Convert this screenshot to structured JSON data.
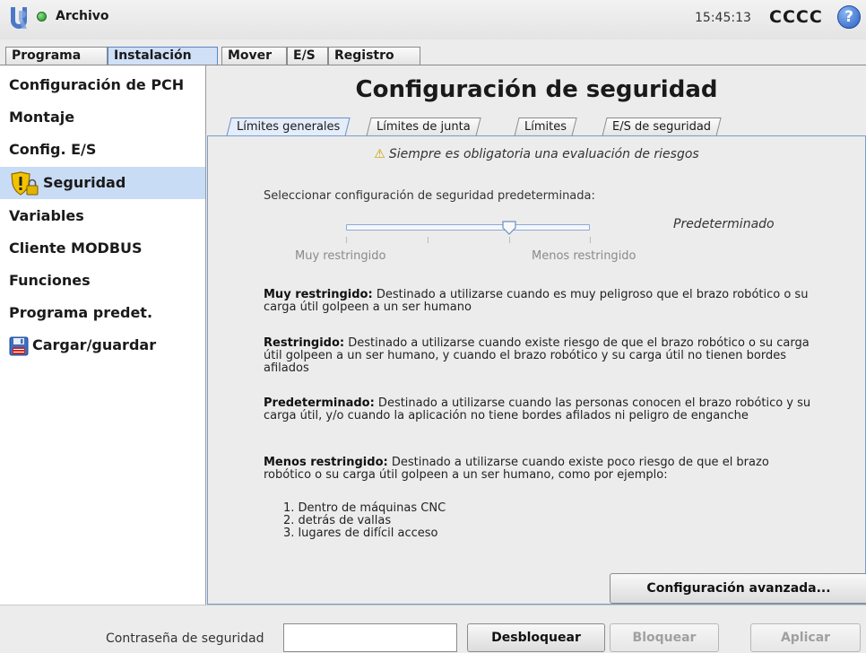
{
  "topbar": {
    "menu_label": "Archivo",
    "time": "15:45:13",
    "robot_name": "CCCC",
    "help_glyph": "?",
    "status_color": "#2a9a2a"
  },
  "main_tabs": [
    {
      "label": "Programa"
    },
    {
      "label": "Instalación"
    },
    {
      "label": "Mover"
    },
    {
      "label": "E/S"
    },
    {
      "label": "Registro"
    }
  ],
  "sidebar": {
    "items": [
      {
        "label": "Configuración de PCH"
      },
      {
        "label": "Montaje"
      },
      {
        "label": "Config. E/S"
      },
      {
        "label": "Seguridad",
        "icon": "shield-lock-icon"
      },
      {
        "label": "Variables"
      },
      {
        "label": "Cliente MODBUS"
      },
      {
        "label": "Funciones"
      },
      {
        "label": "Programa predet."
      },
      {
        "label": "Cargar/guardar",
        "icon": "floppy-disk-icon"
      }
    ]
  },
  "main": {
    "title": "Configuración de seguridad",
    "subtabs": [
      {
        "label": "Límites generales"
      },
      {
        "label": "Límites de junta"
      },
      {
        "label": "Límites"
      },
      {
        "label": "E/S de seguridad"
      }
    ],
    "warning": "Siempre es obligatoria una evaluación de riesgos",
    "select_label": "Seleccionar configuración de seguridad predeterminada:",
    "slider": {
      "min_label": "Muy restringido",
      "max_label": "Menos restringido",
      "value_label": "Predeterminado",
      "position_fraction": 0.67
    },
    "descriptions": [
      {
        "title": "Muy restringido:",
        "text": " Destinado a utilizarse cuando es muy peligroso que el brazo robótico o su carga útil golpeen a un ser humano"
      },
      {
        "title": "Restringido:",
        "text": " Destinado a utilizarse cuando existe riesgo de que el brazo robótico o su carga útil golpeen a un ser humano, y cuando el brazo robótico y su carga útil no tienen bordes afilados"
      },
      {
        "title": "Predeterminado:",
        "text": " Destinado a utilizarse cuando las personas conocen el brazo robótico y su carga útil, y/o cuando la aplicación no tiene bordes afilados ni peligro de enganche"
      },
      {
        "title": "Menos restringido:",
        "text": " Destinado a utilizarse cuando existe poco riesgo de que el brazo robótico o su carga útil golpeen a un ser humano, como por ejemplo:"
      }
    ],
    "examples": [
      {
        "num": "1.",
        "text": "Dentro de máquinas CNC"
      },
      {
        "num": "2.",
        "text": "detrás de vallas"
      },
      {
        "num": "3.",
        "text": "lugares de difícil acceso"
      }
    ],
    "advanced_button": "Configuración avanzada..."
  },
  "bottom": {
    "password_label": "Contraseña de seguridad",
    "password_value": "",
    "unlock_label": "Desbloquear",
    "lock_label": "Bloquear",
    "apply_label": "Aplicar"
  }
}
